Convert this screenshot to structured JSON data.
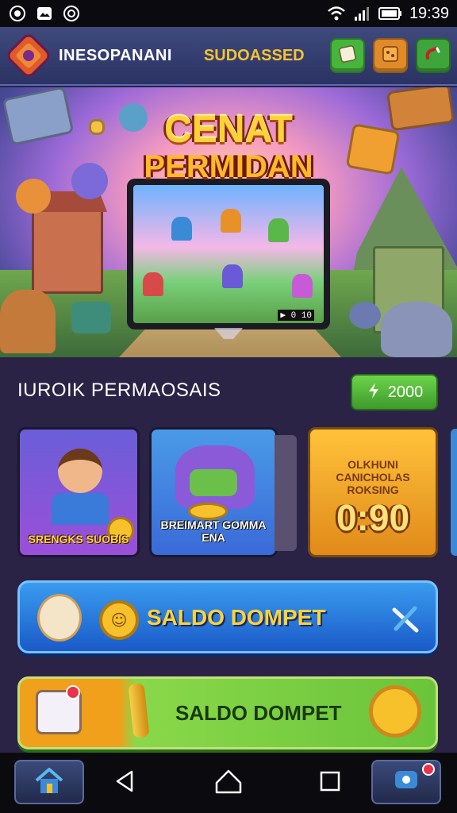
{
  "status_bar": {
    "time": "19:39",
    "icons_left": [
      "whatsapp-icon",
      "gallery-icon",
      "notification-icon"
    ],
    "icons_right": [
      "wifi-icon",
      "signal-icon",
      "battery-icon"
    ]
  },
  "header": {
    "title": "INESOPANANI",
    "subtitle": "SUDOASSED",
    "buttons": [
      "card-icon",
      "box-icon",
      "link-icon"
    ]
  },
  "hero": {
    "title_line1": "CENAT",
    "title_line2": "PERMIDAN",
    "screen_badge": "▶ 0 10"
  },
  "rewards": {
    "title": "IUROIK PERMAOSAIS",
    "coin_value": "2000",
    "cards": [
      {
        "label": "SRENGKS SUOBIS"
      },
      {
        "label": "BREIMART GOMMA ENA"
      },
      {
        "label": "OLKHUNI CANICHOLAS ROKSING",
        "value": "0:90"
      }
    ]
  },
  "wallet": [
    {
      "label": "SALDO DOMPET"
    },
    {
      "label": "SALDO DOMPET"
    }
  ],
  "navbar": {
    "items": [
      "home-icon",
      "back-icon",
      "home-circle-icon",
      "recent-apps-icon",
      "chat-icon"
    ]
  },
  "colors": {
    "accent_gold": "#ffd23a",
    "wallet_blue": "#1a5ac8",
    "wallet_green": "#6ac43a",
    "coin_green": "#3d9a2a"
  }
}
